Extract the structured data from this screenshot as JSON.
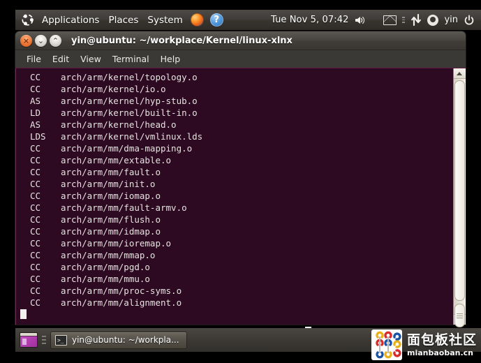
{
  "top_panel": {
    "logo_icon": "ubuntu-logo-icon",
    "menus": [
      {
        "label": "Applications",
        "name": "applications-menu"
      },
      {
        "label": "Places",
        "name": "places-menu"
      },
      {
        "label": "System",
        "name": "system-menu"
      }
    ],
    "launchers": [
      {
        "name": "firefox-icon"
      },
      {
        "name": "help-icon",
        "glyph": "?"
      }
    ],
    "clock": "Tue Nov  5, 07:42",
    "tray": [
      {
        "name": "volume-icon"
      },
      {
        "name": "mail-icon"
      },
      {
        "name": "separator-dots-icon"
      },
      {
        "name": "network-icon"
      }
    ],
    "user": "yin",
    "power_icon": "power-icon"
  },
  "window": {
    "title": "yin@ubuntu: ~/workplace/Kernel/linux-xlnx",
    "buttons": {
      "close": "×",
      "minimize": "⌄",
      "maximize": "⌃"
    },
    "menubar": [
      {
        "label": "File",
        "name": "menu-file"
      },
      {
        "label": "Edit",
        "name": "menu-edit"
      },
      {
        "label": "View",
        "name": "menu-view"
      },
      {
        "label": "Terminal",
        "name": "menu-terminal"
      },
      {
        "label": "Help",
        "name": "menu-help"
      }
    ]
  },
  "terminal": {
    "lines": [
      {
        "tag": "CC",
        "path": "arch/arm/kernel/topology.o"
      },
      {
        "tag": "CC",
        "path": "arch/arm/kernel/io.o"
      },
      {
        "tag": "AS",
        "path": "arch/arm/kernel/hyp-stub.o"
      },
      {
        "tag": "LD",
        "path": "arch/arm/kernel/built-in.o"
      },
      {
        "tag": "AS",
        "path": "arch/arm/kernel/head.o"
      },
      {
        "tag": "LDS",
        "path": "arch/arm/kernel/vmlinux.lds"
      },
      {
        "tag": "CC",
        "path": "arch/arm/mm/dma-mapping.o"
      },
      {
        "tag": "CC",
        "path": "arch/arm/mm/extable.o"
      },
      {
        "tag": "CC",
        "path": "arch/arm/mm/fault.o"
      },
      {
        "tag": "CC",
        "path": "arch/arm/mm/init.o"
      },
      {
        "tag": "CC",
        "path": "arch/arm/mm/iomap.o"
      },
      {
        "tag": "CC",
        "path": "arch/arm/mm/fault-armv.o"
      },
      {
        "tag": "CC",
        "path": "arch/arm/mm/flush.o"
      },
      {
        "tag": "CC",
        "path": "arch/arm/mm/idmap.o"
      },
      {
        "tag": "CC",
        "path": "arch/arm/mm/ioremap.o"
      },
      {
        "tag": "CC",
        "path": "arch/arm/mm/mmap.o"
      },
      {
        "tag": "CC",
        "path": "arch/arm/mm/pgd.o"
      },
      {
        "tag": "CC",
        "path": "arch/arm/mm/mmu.o"
      },
      {
        "tag": "CC",
        "path": "arch/arm/mm/proc-syms.o"
      },
      {
        "tag": "CC",
        "path": "arch/arm/mm/alignment.o"
      }
    ],
    "cursor": "block-cursor",
    "colors": {
      "background": "#2d0a22",
      "foreground": "#e6e3e0"
    }
  },
  "scrollbar": {
    "up_arrow": "scroll-up-arrow-icon",
    "down_arrow": "scroll-down-arrow-icon",
    "thumb": "scrollbar-thumb"
  },
  "bottom_panel": {
    "show_desktop_icon": "show-desktop-icon",
    "tasks": [
      {
        "label": "yin@ubuntu: ~/workpla...",
        "icon": "terminal-icon"
      }
    ]
  },
  "watermark": {
    "cn": "面包板社区",
    "en": "mianbaoban.cn",
    "logo": "mianbaoban-logo-icon"
  }
}
